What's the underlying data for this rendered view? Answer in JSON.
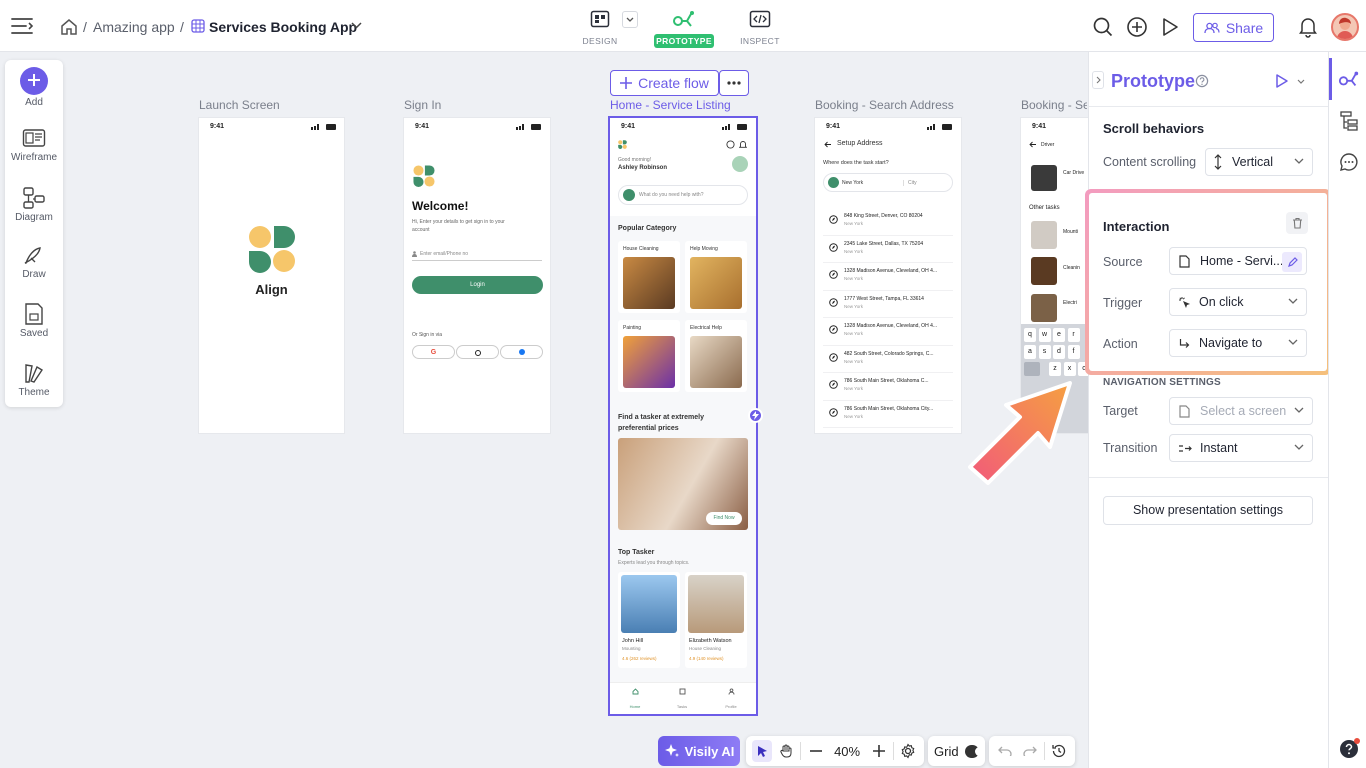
{
  "breadcrumb": {
    "project": "Amazing app",
    "file": "Services Booking App"
  },
  "modes": {
    "design": "DESIGN",
    "prototype": "PROTOTYPE",
    "inspect": "INSPECT"
  },
  "header": {
    "share": "Share"
  },
  "toolbar": {
    "add": "Add",
    "wireframe": "Wireframe",
    "diagram": "Diagram",
    "draw": "Draw",
    "saved": "Saved",
    "theme": "Theme"
  },
  "canvas": {
    "create_flow": "Create flow",
    "frames": [
      "Launch Screen",
      "Sign In",
      "Home - Service Listing",
      "Booking - Search Address",
      "Booking - Se"
    ],
    "time": "9:41",
    "launch": {
      "brand": "Align"
    },
    "signin": {
      "title": "Welcome!",
      "subtitle": "Hi, Enter your details to get sign in to your account",
      "email_placeholder": "Enter email/Phone no",
      "login": "Login",
      "or": "Or Sign in via"
    },
    "home": {
      "greeting": "Good morning!",
      "user": "Ashley Robinson",
      "search": "What do you need help with?",
      "popular": "Popular Category",
      "cats": [
        "House Cleaning",
        "Help Moving",
        "Painting",
        "Electrical Help"
      ],
      "promo": "Find a tasker at extremely preferential prices",
      "find_now": "Find Now",
      "top_tasker": "Top Tasker",
      "top_sub": "Experts lead you through topics.",
      "taskers": [
        {
          "name": "John Hill",
          "role": "Mounting",
          "rating": "4.6 (262 reviews)"
        },
        {
          "name": "Elizabeth Watson",
          "role": "House Cleaning",
          "rating": "4.9 (140 reviews)"
        }
      ],
      "nav": [
        "Home",
        "Tasks",
        "Profile"
      ]
    },
    "address": {
      "title": "Setup Address",
      "question": "Where does the task start?",
      "city_value": "New York",
      "city_ph": "City",
      "list": [
        "848 King Street, Denver, CO 80204",
        "2345 Lake Street, Dallas, TX 75204",
        "1328 Madison Avenue, Cleveland, OH 4...",
        "1777 West Street, Tampa, FL 33614",
        "1328 Madison Avenue, Cleveland, OH 4...",
        "482 South Street, Colorado Springs, C...",
        "786 South Main Street, Oklahoma C...",
        "786 South Main Street, Oklahoma City..."
      ],
      "list_sub": "New York"
    },
    "booking": {
      "header": "Driver",
      "item": "Car Drive",
      "other": "Other tasks",
      "items": [
        "Mounti",
        "Cleanin",
        "Electri"
      ],
      "keys1": [
        "q",
        "w",
        "e",
        "r"
      ],
      "keys2": [
        "a",
        "s",
        "d",
        "f"
      ],
      "keys3": [
        "z",
        "x",
        "c"
      ]
    }
  },
  "bottombar": {
    "ai": "Visily AI",
    "zoom": "40%",
    "grid": "Grid"
  },
  "panel": {
    "title": "Prototype",
    "scroll_heading": "Scroll behaviors",
    "content_scrolling_label": "Content scrolling",
    "content_scrolling_value": "Vertical",
    "interaction_heading": "Interaction",
    "source_label": "Source",
    "source_value": "Home - Servi...",
    "trigger_label": "Trigger",
    "trigger_value": "On click",
    "action_label": "Action",
    "action_value": "Navigate to",
    "nav_heading": "NAVIGATION SETTINGS",
    "target_label": "Target",
    "target_placeholder": "Select a screen",
    "transition_label": "Transition",
    "transition_value": "Instant",
    "presentation": "Show presentation settings"
  },
  "colors": {
    "accent": "#6c5ce7",
    "brand": "#3f8f6b",
    "prototype": "#2fbf71"
  }
}
